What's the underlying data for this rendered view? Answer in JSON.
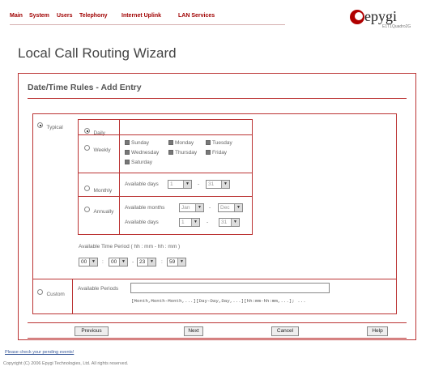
{
  "nav": {
    "main": "Main",
    "system": "System",
    "users": "Users",
    "telephony": "Telephony",
    "internet_uplink": "Internet Uplink",
    "lan_services": "LAN Services"
  },
  "logo": {
    "word": "epygi",
    "model": "E1T1Quadro2G"
  },
  "page_title": "Local Call Routing Wizard",
  "section_title": "Date/Time Rules - Add Entry",
  "typical": {
    "label": "Typical",
    "daily": "Daily",
    "weekly": {
      "label": "Weekly",
      "days": [
        "Sunday",
        "Monday",
        "Tuesday",
        "Wednesday",
        "Thursday",
        "Friday",
        "Saturday"
      ]
    },
    "monthly": {
      "label": "Monthly",
      "available_days": "Available days",
      "from": "1",
      "to": "31",
      "dash": "-"
    },
    "annually": {
      "label": "Annually",
      "available_months": "Available months",
      "month_from": "Jan",
      "month_to": "Dec",
      "available_days": "Available days",
      "day_from": "1",
      "day_to": "31",
      "dash": "-"
    },
    "time_period": {
      "label": "Available Time Period ( hh : mm - hh : mm )",
      "h1": "00",
      "m1": "00",
      "h2": "23",
      "m2": "59",
      "colon": ":",
      "dash": "-"
    }
  },
  "custom": {
    "label": "Custom",
    "periods_label": "Available Periods",
    "periods_value": "",
    "format_hint": "[Month,Month-Month,...][Day-Day,Day,...][hh:mm-hh:mm,...]; ..."
  },
  "buttons": {
    "previous": "Previous",
    "next": "Next",
    "cancel": "Cancel",
    "help": "Help"
  },
  "footer": {
    "link": "Please check your pending events!",
    "copyright": "Copyright (C) 2006 Epygi Technologies, Ltd. All rights reserved."
  },
  "colors": {
    "accent": "#a00000",
    "border": "#bb3333"
  }
}
